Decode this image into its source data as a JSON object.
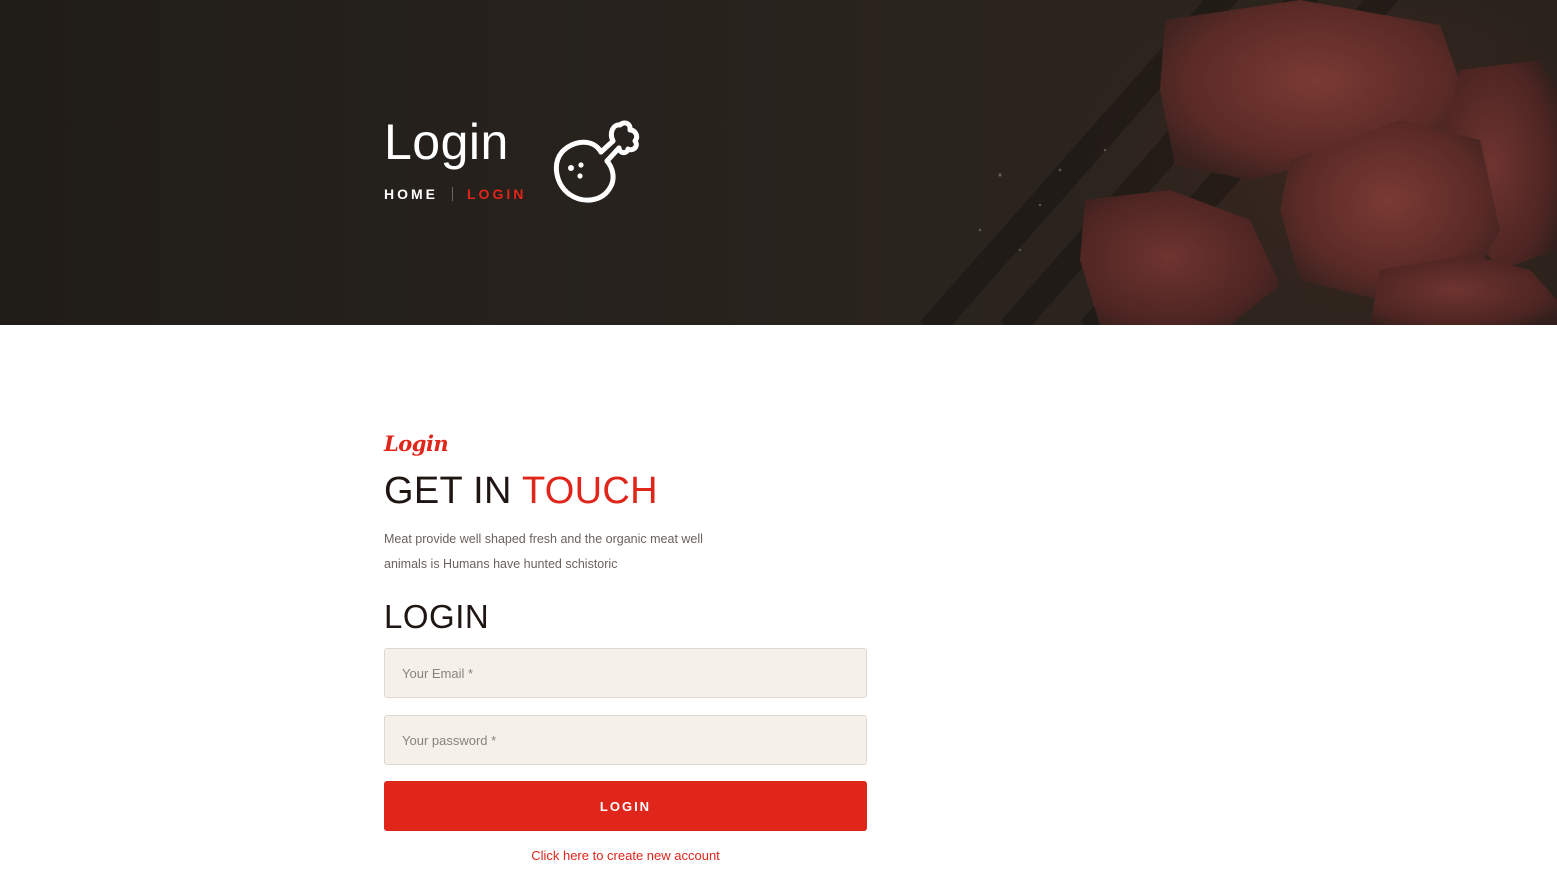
{
  "hero": {
    "title": "Login",
    "breadcrumb": {
      "home": "HOME",
      "current": "LOGIN"
    },
    "icon": "chicken-leg-icon"
  },
  "intro": {
    "script_label": "Login",
    "heading_main": "GET IN ",
    "heading_accent": "TOUCH",
    "description": "Meat provide well shaped fresh and the organic meat well animals is Humans have hunted schistoric"
  },
  "form": {
    "title": "LOGIN",
    "email_placeholder": "Your Email *",
    "password_placeholder": "Your password *",
    "submit_label": "LOGIN",
    "create_account_link": "Click here to create new account"
  },
  "colors": {
    "accent": "#e0251a",
    "hero_background": "#231e19",
    "field_background": "#f5f0ea",
    "heading_text": "#1f1512"
  }
}
